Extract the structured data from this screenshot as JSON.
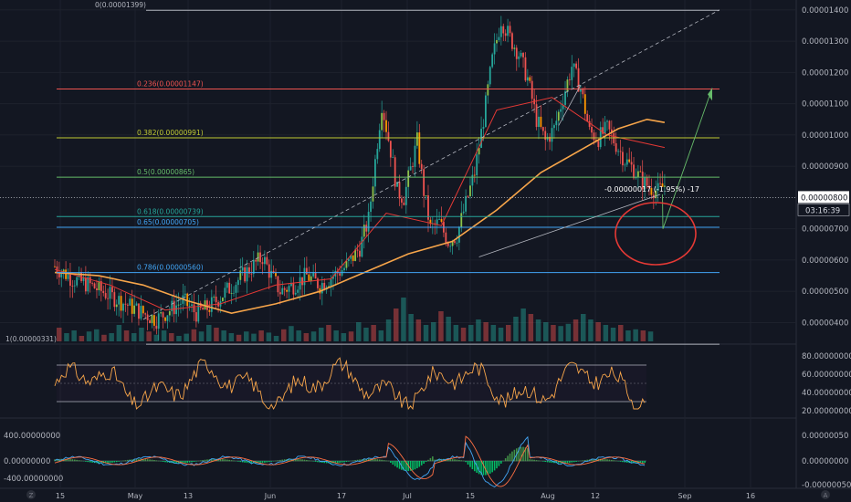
{
  "chart_data": [
    {
      "type": "candlestick",
      "title": "",
      "price_axis_labels": [
        "0.00001400",
        "0.00001300",
        "0.00001200",
        "0.00001100",
        "0.00001000",
        "0.00000900",
        "0.00000800",
        "0.00000700",
        "0.00000600",
        "0.00000500",
        "0.00000400"
      ],
      "ylim": [
        3.4e-06,
        1.42e-05
      ],
      "current_price": "0.00000800",
      "countdown": "03:16:39",
      "measure_label": "-0.00000017 (-1.95%) -17",
      "fib_levels": [
        {
          "label": "0(0.00001399)",
          "value": 1.399e-05,
          "color": "#b2b5be"
        },
        {
          "label": "0.236(0.00001147)",
          "value": 1.147e-05,
          "color": "#ef5350"
        },
        {
          "label": "0.382(0.00000991)",
          "value": 9.91e-06,
          "color": "#c0ca33"
        },
        {
          "label": "0.5(0.00000865)",
          "value": 8.65e-06,
          "color": "#66bb6a"
        },
        {
          "label": "0.618(0.00000739)",
          "value": 7.39e-06,
          "color": "#26a69a"
        },
        {
          "label": "0.65(0.00000705)",
          "value": 7.05e-06,
          "color": "#42a5f5"
        },
        {
          "label": "0.786(0.00000560)",
          "value": 5.6e-06,
          "color": "#42a5f5"
        },
        {
          "label": "1(0.00000331)",
          "value": 3.31e-06,
          "color": "#b2b5be"
        }
      ],
      "price_path": [
        [
          0,
          5.8e-06
        ],
        [
          8,
          5.4e-06
        ],
        [
          16,
          5.2e-06
        ],
        [
          24,
          4.9e-06
        ],
        [
          32,
          4.6e-06
        ],
        [
          40,
          4.3e-06
        ],
        [
          46,
          4.1e-06
        ],
        [
          52,
          4.4e-06
        ],
        [
          58,
          4.7e-06
        ],
        [
          64,
          4.3e-06
        ],
        [
          70,
          4.5e-06
        ],
        [
          76,
          4.9e-06
        ],
        [
          82,
          5.3e-06
        ],
        [
          88,
          5.7e-06
        ],
        [
          94,
          6.1e-06
        ],
        [
          98,
          5.5e-06
        ],
        [
          102,
          5e-06
        ],
        [
          108,
          5.2e-06
        ],
        [
          114,
          5.5e-06
        ],
        [
          120,
          5.2e-06
        ],
        [
          126,
          5.5e-06
        ],
        [
          132,
          5.8e-06
        ],
        [
          138,
          6.4e-06
        ],
        [
          142,
          7.3e-06
        ],
        [
          146,
          9.8e-06
        ],
        [
          148,
          1.1e-05
        ],
        [
          152,
          9.5e-06
        ],
        [
          155,
          8.2e-06
        ],
        [
          158,
          8e-06
        ],
        [
          161,
          8.9e-06
        ],
        [
          164,
          9.8e-06
        ],
        [
          167,
          8.2e-06
        ],
        [
          170,
          7e-06
        ],
        [
          174,
          7.2e-06
        ],
        [
          178,
          6.6e-06
        ],
        [
          182,
          6.8e-06
        ],
        [
          186,
          7.8e-06
        ],
        [
          190,
          8.8e-06
        ],
        [
          194,
          1.05e-05
        ],
        [
          198,
          1.24e-05
        ],
        [
          202,
          1.37e-05
        ],
        [
          206,
          1.31e-05
        ],
        [
          210,
          1.26e-05
        ],
        [
          214,
          1.18e-05
        ],
        [
          218,
          1.05e-05
        ],
        [
          222,
          9.8e-06
        ],
        [
          226,
          1.02e-05
        ],
        [
          230,
          1.12e-05
        ],
        [
          234,
          1.22e-05
        ],
        [
          238,
          1.15e-05
        ],
        [
          242,
          1.01e-05
        ],
        [
          246,
          9.9e-06
        ],
        [
          250,
          1.02e-05
        ],
        [
          254,
          9.7e-06
        ],
        [
          258,
          9.2e-06
        ],
        [
          262,
          8.9e-06
        ],
        [
          266,
          8.5e-06
        ],
        [
          270,
          8.3e-06
        ],
        [
          273,
          8.2e-06
        ],
        [
          276,
          8.4e-06
        ]
      ],
      "ma_orange": [
        [
          0,
          5.6e-06
        ],
        [
          20,
          5.5e-06
        ],
        [
          40,
          5.2e-06
        ],
        [
          60,
          4.7e-06
        ],
        [
          80,
          4.3e-06
        ],
        [
          100,
          4.6e-06
        ],
        [
          120,
          5e-06
        ],
        [
          140,
          5.6e-06
        ],
        [
          160,
          6.2e-06
        ],
        [
          180,
          6.6e-06
        ],
        [
          200,
          7.6e-06
        ],
        [
          220,
          8.8e-06
        ],
        [
          240,
          9.6e-06
        ],
        [
          255,
          1.02e-05
        ],
        [
          268,
          1.05e-05
        ],
        [
          276,
          1.04e-05
        ]
      ],
      "ma_red": [
        [
          0,
          5.7e-06
        ],
        [
          25,
          5.2e-06
        ],
        [
          50,
          4.4e-06
        ],
        [
          75,
          4.6e-06
        ],
        [
          100,
          5.2e-06
        ],
        [
          125,
          5.4e-06
        ],
        [
          150,
          7.5e-06
        ],
        [
          175,
          7.1e-06
        ],
        [
          200,
          1.08e-05
        ],
        [
          225,
          1.12e-05
        ],
        [
          250,
          1e-05
        ],
        [
          276,
          9.6e-06
        ]
      ],
      "volume": [
        0.25,
        0.15,
        0.2,
        0.1,
        0.18,
        0.22,
        0.12,
        0.15,
        0.3,
        0.2,
        0.15,
        0.25,
        0.18,
        0.12,
        0.2,
        0.15,
        0.1,
        0.14,
        0.22,
        0.18,
        0.3,
        0.25,
        0.2,
        0.15,
        0.12,
        0.18,
        0.14,
        0.2,
        0.16,
        0.1,
        0.22,
        0.28,
        0.2,
        0.15,
        0.18,
        0.25,
        0.3,
        0.2,
        0.15,
        0.18,
        0.35,
        0.25,
        0.3,
        0.2,
        0.4,
        0.6,
        0.8,
        0.5,
        0.4,
        0.3,
        0.35,
        0.55,
        0.45,
        0.3,
        0.25,
        0.3,
        0.4,
        0.35,
        0.3,
        0.25,
        0.3,
        0.45,
        0.6,
        0.5,
        0.4,
        0.35,
        0.3,
        0.28,
        0.32,
        0.4,
        0.5,
        0.4,
        0.35,
        0.3,
        0.25,
        0.3,
        0.2,
        0.22,
        0.2,
        0.18
      ],
      "x_axis_labels": [
        "15",
        "May",
        "13",
        "Jun",
        "17",
        "Jul",
        "15",
        "Aug",
        "12",
        "Sep",
        "16"
      ]
    },
    {
      "type": "line",
      "name": "RSI",
      "axis_labels": [
        "80.00000000",
        "60.00000000",
        "40.00000000",
        "20.00000000"
      ],
      "ylim": [
        15,
        90
      ],
      "bands": [
        70,
        30
      ],
      "mid": 50
    },
    {
      "type": "line",
      "name": "MACD",
      "left_axis_labels": [
        "400.00000000",
        "0.00000000",
        "-400.00000000"
      ],
      "right_axis_labels": [
        "0.00000050",
        "0.00000000",
        "-0.00000050"
      ]
    }
  ],
  "ui": {
    "tv_logo_left": "Z",
    "tv_logo_right": "A"
  }
}
